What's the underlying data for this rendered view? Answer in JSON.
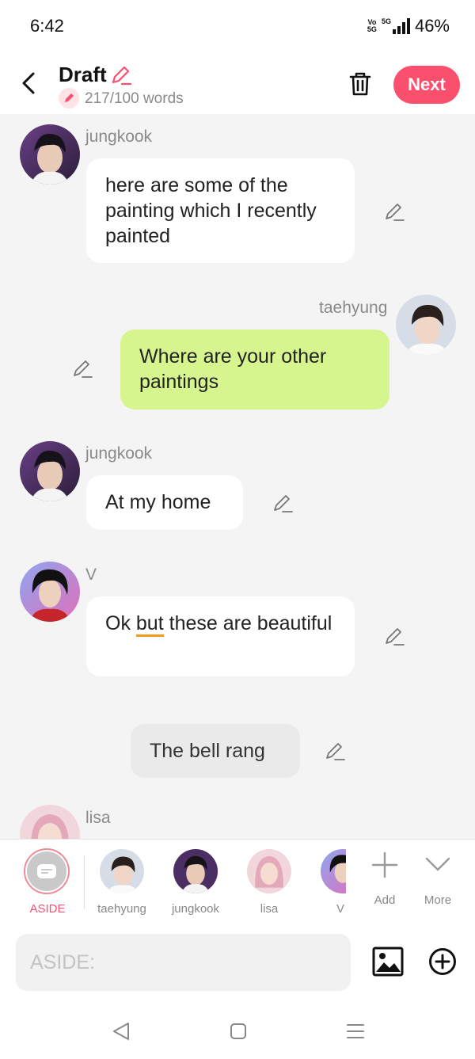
{
  "status": {
    "time": "6:42",
    "network_top": "Vo",
    "network_bottom": "5G",
    "signal_label": "5G",
    "battery": "46%"
  },
  "header": {
    "title": "Draft",
    "word_count": "217/100 words",
    "next_label": "Next"
  },
  "messages": [
    {
      "sender": "jungkook",
      "text": "here are some of the painting which I recently painted"
    },
    {
      "sender": "taehyung",
      "text": "Where are your other paintings"
    },
    {
      "sender": "jungkook",
      "text": "At my home"
    },
    {
      "sender": "V",
      "text_before": "Ok",
      "text_underlined": "but",
      "text_after": "these are beautiful"
    },
    {
      "narration": "The bell rang"
    },
    {
      "sender": "lisa"
    }
  ],
  "cast": {
    "aside": "ASIDE",
    "members": [
      "taehyung",
      "jungkook",
      "lisa",
      "V"
    ],
    "add": "Add",
    "more": "More"
  },
  "input": {
    "placeholder": "ASIDE:"
  },
  "colors": {
    "accent": "#fb4f6e",
    "green_bubble": "#d6f58e",
    "background": "#f4f4f4"
  },
  "icons": [
    "back-arrow-icon",
    "pencil-icon",
    "trash-icon",
    "image-icon",
    "plus-circle-icon",
    "plus-icon",
    "chevron-down-icon",
    "nav-back-icon",
    "nav-home-icon",
    "nav-recents-icon"
  ]
}
